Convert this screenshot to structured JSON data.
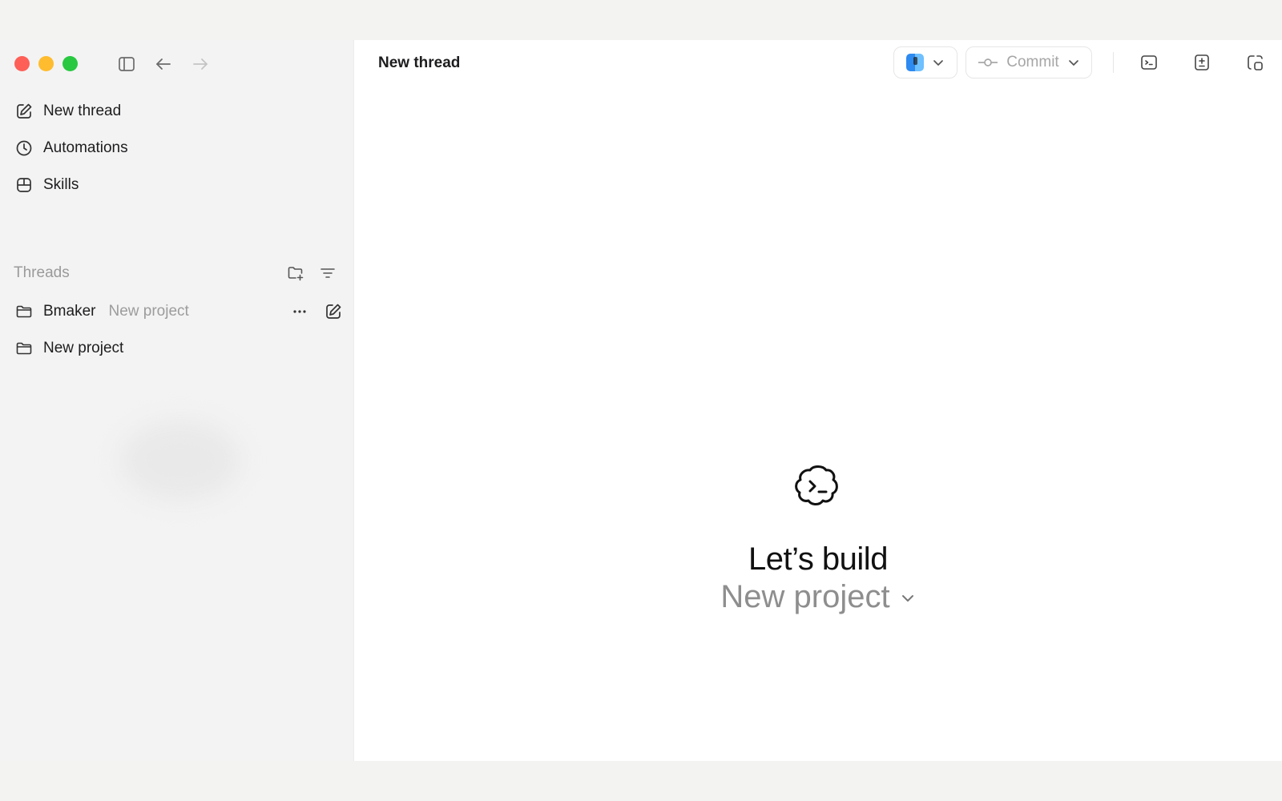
{
  "sidebar": {
    "nav": [
      {
        "label": "New thread",
        "icon": "compose-icon"
      },
      {
        "label": "Automations",
        "icon": "clock-icon"
      },
      {
        "label": "Skills",
        "icon": "skills-icon"
      }
    ],
    "threads_label": "Threads",
    "projects": [
      {
        "name": "Bmaker",
        "sub": "New project"
      },
      {
        "name": "New project",
        "sub": ""
      }
    ]
  },
  "main": {
    "title": "New thread",
    "toolbar": {
      "commit_label": "Commit"
    },
    "hero": "Let’s build",
    "project": "New project"
  },
  "colors": {
    "close": "#fe5f57",
    "minimize": "#febc2e",
    "zoom": "#28c840",
    "muted_text": "#9c9c9c",
    "sidebar_bg": "#f3f3f3",
    "main_bg": "#ffffff"
  }
}
